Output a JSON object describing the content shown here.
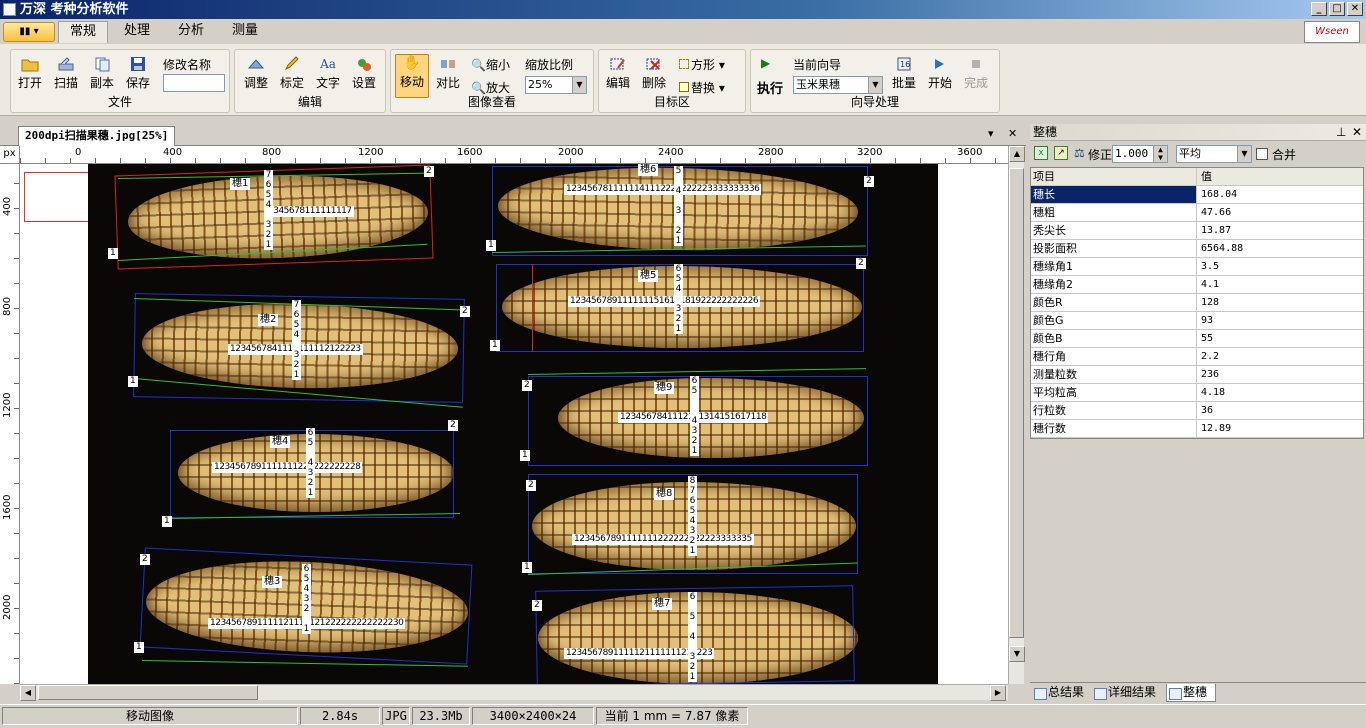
{
  "window": {
    "title": "万深 考种分析软件",
    "buttons": [
      "_",
      "□",
      "✕"
    ]
  },
  "brand": {
    "logo_text": "Wseen"
  },
  "ribbon_tabs": {
    "app_menu_label": "▾",
    "tabs": [
      "常规",
      "处理",
      "分析",
      "测量"
    ],
    "active": "常规"
  },
  "ribbon": {
    "file_group": {
      "label": "文件",
      "open": "打开",
      "scan": "扫描",
      "copy": "副本",
      "save": "保存",
      "rename_label": "修改名称",
      "rename_value": ""
    },
    "edit_group": {
      "label": "编辑",
      "adjust": "调整",
      "calibrate": "标定",
      "text": "文字",
      "settings": "设置"
    },
    "view_group": {
      "label": "图像查看",
      "move": "移动",
      "compare": "对比",
      "zoom_out": "缩小",
      "zoom_in": "放大",
      "scale_label": "缩放比例",
      "scale_value": "25%"
    },
    "target_group": {
      "label": "目标区",
      "edit": "编辑",
      "delete": "删除",
      "square": "方形",
      "replace": "替换"
    },
    "wizard_group": {
      "label": "向导处理",
      "current_label": "当前向导",
      "execute": "执行",
      "wizard_value": "玉米果穗",
      "batch": "批量",
      "start": "开始",
      "finish": "完成"
    }
  },
  "document": {
    "tab_title": "200dpi扫描果穗.jpg[25%]",
    "tab_close": "✕",
    "tab_menu": "▾"
  },
  "ruler": {
    "unit": "px",
    "h_labels": [
      "0",
      "400",
      "800",
      "1200",
      "1600",
      "2000",
      "2400",
      "2800",
      "3200",
      "3600"
    ],
    "v_labels": [
      "400",
      "800",
      "1200",
      "1600",
      "2000"
    ]
  },
  "ears": [
    {
      "name": "穗1",
      "counts": "2345678111111117",
      "col": [
        "7",
        "6",
        "5",
        "4",
        "3",
        "2",
        "1"
      ]
    },
    {
      "name": "穗2",
      "counts": "1234567841111111112122223",
      "col": [
        "7",
        "6",
        "5",
        "4",
        "3",
        "2",
        "1"
      ]
    },
    {
      "name": "穗3",
      "counts": "1234567891111121112121222222222222230",
      "col": [
        "6",
        "5",
        "4",
        "3",
        "2",
        "1"
      ]
    },
    {
      "name": "穗4",
      "counts": "1234567891111111222222222228",
      "col": [
        "6",
        "5",
        "4",
        "3",
        "2",
        "1"
      ]
    },
    {
      "name": "穗5",
      "counts": "123456789111111151617181922222222226",
      "col": [
        "6",
        "5",
        "4",
        "3",
        "2",
        "1"
      ]
    },
    {
      "name": "穗6",
      "counts": "1234567811111141112222222223333333336",
      "col": [
        "5",
        "4",
        "3",
        "2",
        "1"
      ]
    },
    {
      "name": "穗7",
      "counts": "1234567891111121111111212223",
      "col": [
        "6",
        "5",
        "4",
        "3",
        "2",
        "1"
      ]
    },
    {
      "name": "穗8",
      "counts": "1234567891111111222222222223333335",
      "col": [
        "8",
        "7",
        "6",
        "5",
        "4",
        "3",
        "2",
        "1"
      ]
    },
    {
      "name": "穗9",
      "counts": "1234567841112121314151617118",
      "col": [
        "6",
        "5",
        "4",
        "3",
        "2",
        "1"
      ]
    }
  ],
  "panel": {
    "title": "整穗",
    "pin": "⊥",
    "close": "✕",
    "correction_label": "修正:",
    "correction_value": "1.000",
    "mode_value": "平均",
    "merge_label": "合并",
    "headers": {
      "item": "项目",
      "value": "值"
    },
    "rows": [
      {
        "item": "穗长",
        "value": "168.04"
      },
      {
        "item": "穗粗",
        "value": "47.66"
      },
      {
        "item": "秃尖长",
        "value": "13.87"
      },
      {
        "item": "投影面积",
        "value": "6564.88"
      },
      {
        "item": "穗缘角1",
        "value": "3.5"
      },
      {
        "item": "穗缘角2",
        "value": "4.1"
      },
      {
        "item": "颜色R",
        "value": "128"
      },
      {
        "item": "颜色G",
        "value": "93"
      },
      {
        "item": "颜色B",
        "value": "55"
      },
      {
        "item": "穗行角",
        "value": "2.2"
      },
      {
        "item": "测量粒数",
        "value": "236"
      },
      {
        "item": "平均粒高",
        "value": "4.18"
      },
      {
        "item": "行粒数",
        "value": "36"
      },
      {
        "item": "穗行数",
        "value": "12.89"
      }
    ],
    "tabs": [
      "总结果",
      "详细结果",
      "整穗"
    ]
  },
  "status": {
    "mode": "移动图像",
    "time": "2.84s",
    "format": "JPG",
    "size": "23.3Mb",
    "dims": "3400×2400×24",
    "scale": "当前 1 mm = 7.87 像素"
  },
  "colors": {
    "title_bar": "#0a246a",
    "bbox": "#2030d0",
    "red_bbox": "#e02020",
    "green_line": "#30c030",
    "selection": "#0a246a"
  }
}
